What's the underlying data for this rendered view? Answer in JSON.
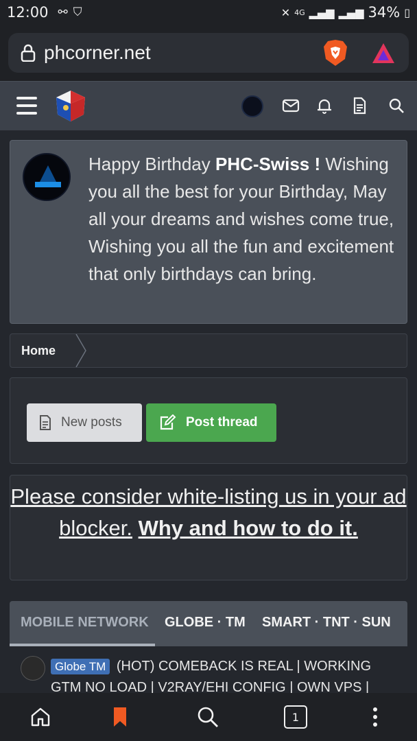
{
  "status_bar": {
    "time": "12:00",
    "network": "4G",
    "battery": "34%"
  },
  "browser": {
    "url": "phcorner.net",
    "accent_brave": "#f05a22",
    "accent_rewards": "#e2355c"
  },
  "site_header": {
    "icons": [
      "menu-icon",
      "site-logo",
      "avatar",
      "mail-icon",
      "bell-icon",
      "document-icon",
      "search-icon"
    ]
  },
  "birthday": {
    "prefix": "Happy Birthday ",
    "username": "PHC-Swiss !",
    "message": " Wishing you all the best for your Birthday, May all your dreams and wishes come true, Wishing you all the fun and excitement that only birthdays can bring."
  },
  "breadcrumb": {
    "home": "Home"
  },
  "actions": {
    "new_posts": "New posts",
    "post_thread": "Post thread",
    "post_thread_color": "#4ba74f"
  },
  "ad_notice": {
    "text": "Please consider white-listing us in your ad blocker.",
    "link": "Why and how to do it."
  },
  "tabs": {
    "items": [
      "MOBILE NETWORK",
      "GLOBE · TM",
      "SMART · TNT · SUN"
    ],
    "active_index": 0
  },
  "thread": {
    "prefix": "Globe TM",
    "title": "(HOT) COMEBACK IS REAL | WORKING GTM NO LOAD | V2RAY/EHI CONFIG | OWN VPS |"
  },
  "bottom_nav": {
    "tab_count": "1",
    "icons": [
      "home-icon",
      "bookmark-icon",
      "search-icon",
      "tabs-icon",
      "more-icon"
    ]
  }
}
